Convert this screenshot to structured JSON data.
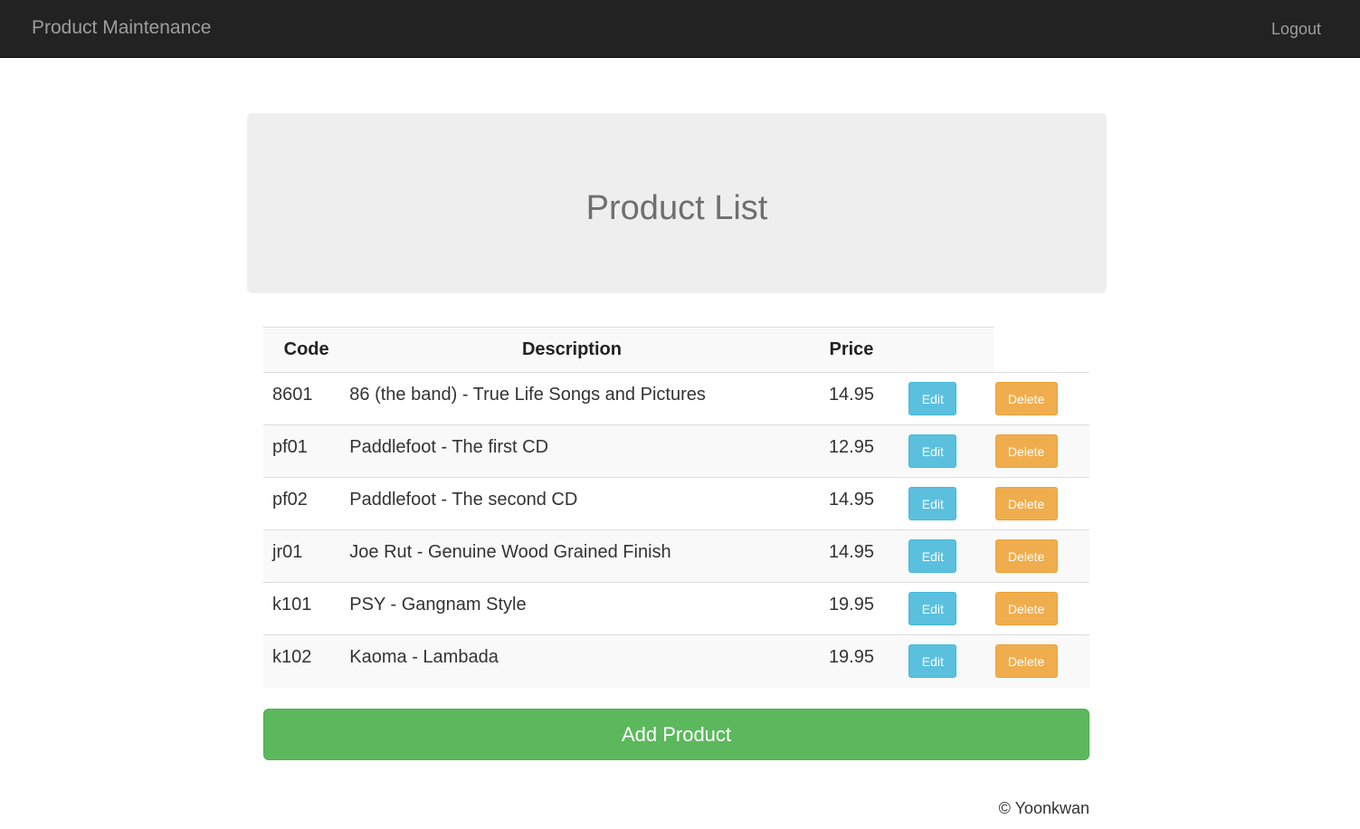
{
  "navbar": {
    "brand": "Product Maintenance",
    "logout": "Logout"
  },
  "jumbotron": {
    "title": "Product List"
  },
  "table": {
    "headers": {
      "code": "Code",
      "description": "Description",
      "price": "Price"
    },
    "rows": [
      {
        "code": "8601",
        "description": "86 (the band) - True Life Songs and Pictures",
        "price": "14.95",
        "edit": "Edit",
        "delete": "Delete"
      },
      {
        "code": "pf01",
        "description": "Paddlefoot - The first CD",
        "price": "12.95",
        "edit": "Edit",
        "delete": "Delete"
      },
      {
        "code": "pf02",
        "description": "Paddlefoot - The second CD",
        "price": "14.95",
        "edit": "Edit",
        "delete": "Delete"
      },
      {
        "code": "jr01",
        "description": "Joe Rut - Genuine Wood Grained Finish",
        "price": "14.95",
        "edit": "Edit",
        "delete": "Delete"
      },
      {
        "code": "k101",
        "description": "PSY - Gangnam Style",
        "price": "19.95",
        "edit": "Edit",
        "delete": "Delete"
      },
      {
        "code": "k102",
        "description": "Kaoma - Lambada",
        "price": "19.95",
        "edit": "Edit",
        "delete": "Delete"
      }
    ]
  },
  "add_button": "Add Product",
  "footer": "© Yoonkwan",
  "colors": {
    "navbar_bg": "#222222",
    "jumbotron_bg": "#eeeeee",
    "edit_btn": "#5bc0de",
    "delete_btn": "#f0ad4e",
    "add_btn": "#5cb85c"
  }
}
